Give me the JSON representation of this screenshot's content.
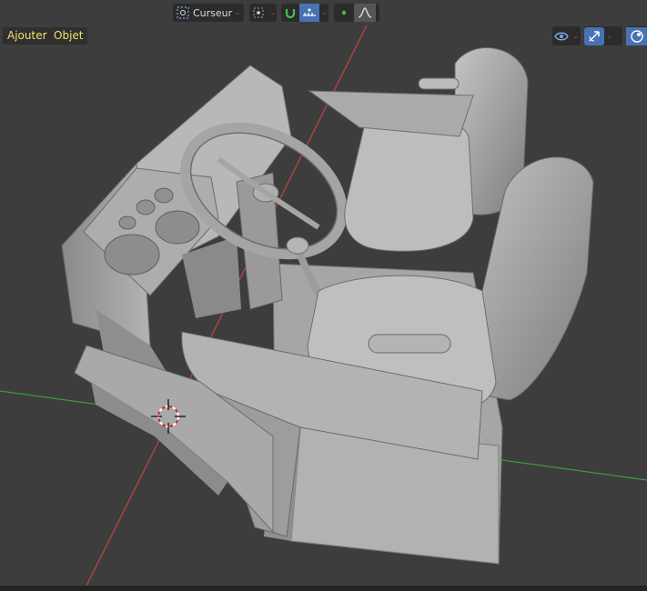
{
  "header": {
    "pivot_label": "Curseur",
    "icons": [
      "pivot-point-icon",
      "snap-target-icon",
      "snap-magnet-icon",
      "snap-increment-icon",
      "proportional-edit-dot-icon",
      "falloff-curve-icon"
    ]
  },
  "menus": {
    "add_label": "Ajouter",
    "object_label": "Objet"
  },
  "viewport": {
    "background": "#3d3d3d",
    "axis_x_color": "#c2463b",
    "axis_y_color": "#3d9b3d",
    "model_color": "#9c9c9c",
    "tools_right": [
      "visibility-eye-icon",
      "gizmo-toggle-icon",
      "overlay-sphere-icon"
    ]
  }
}
